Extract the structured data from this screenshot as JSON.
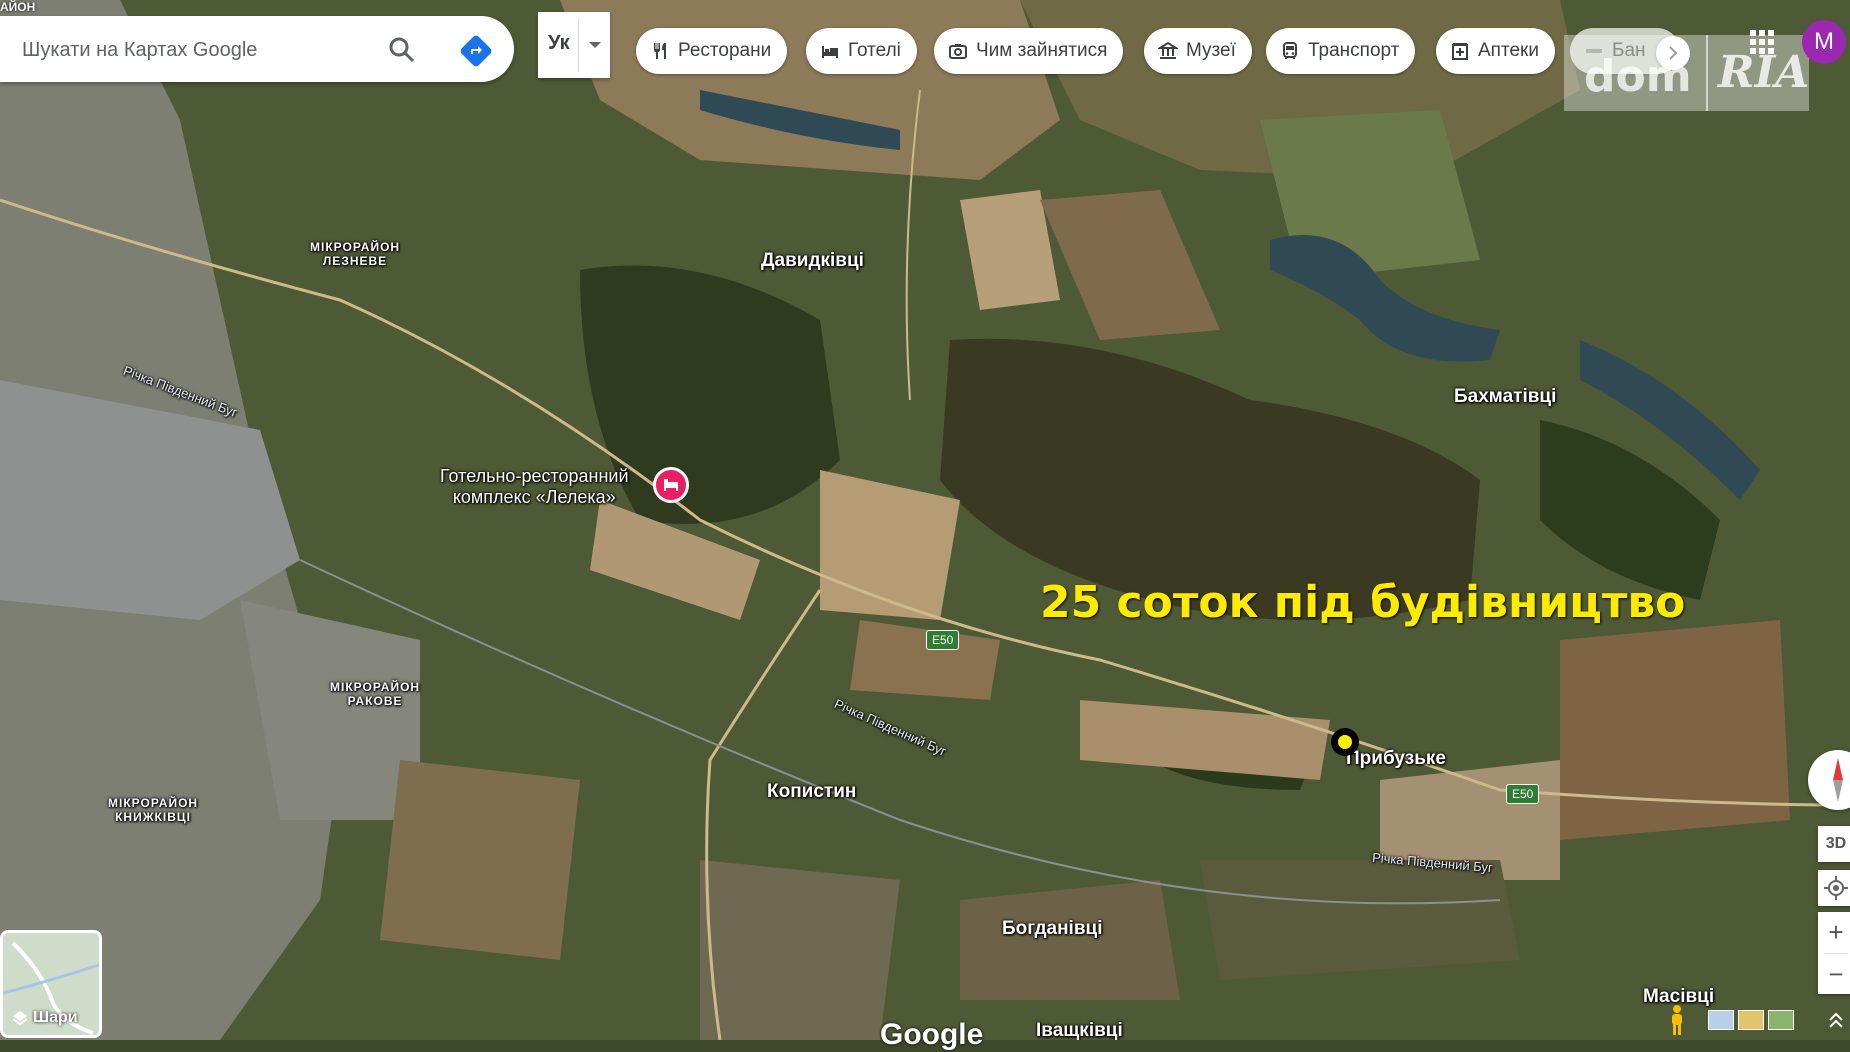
{
  "search": {
    "placeholder": "Шукати на Картах Google"
  },
  "language": {
    "label": "Ук"
  },
  "chips": [
    {
      "label": "Ресторани",
      "icon": "restaurant-icon"
    },
    {
      "label": "Готелі",
      "icon": "hotel-icon"
    },
    {
      "label": "Чим зайнятися",
      "icon": "camera-icon"
    },
    {
      "label": "Музеї",
      "icon": "museum-icon"
    },
    {
      "label": "Транспорт",
      "icon": "transit-icon"
    },
    {
      "label": "Аптеки",
      "icon": "pharmacy-icon"
    },
    {
      "label": "Бан",
      "icon": "bank-icon"
    }
  ],
  "watermark": {
    "left": "dom",
    "right": "RIA"
  },
  "account": {
    "initial": "M",
    "color": "#9c27b0"
  },
  "corner_fragment": "АЙОН",
  "places": {
    "leznevo": [
      "МІКРОРАЙОН",
      "ЛЕЗНЕВЕ"
    ],
    "rakove": [
      "МІКРОРАЙОН",
      "РАКОВЕ"
    ],
    "knyzhkivtsi": [
      "МІКРОРАЙОН",
      "КНИЖКІВЦІ"
    ],
    "davydkivtsi": "Давидківці",
    "bakhmativtsi": "Бахматівці",
    "prybuzke": "Прибузьке",
    "kopystyn": "Копистин",
    "bohdanivtsi": "Богданівці",
    "ivashkivtsi": "Іващківці",
    "masivtsi": "Масівці",
    "river_1": "Річка Південний Буг",
    "river_2": "Річка Південний Буг",
    "river_3": "Річка Південний Буг"
  },
  "poi": {
    "line1": "Готельно-ресторанний",
    "line2": "комплекс «Лелека»"
  },
  "road": {
    "shield_1": "E50",
    "shield_2": "E50"
  },
  "headline": "25 соток під будівництво",
  "layers": {
    "label": "Шари"
  },
  "controls": {
    "three_d": "3D",
    "zoom_in": "+",
    "zoom_out": "−"
  },
  "google_logo": "Google",
  "colors": {
    "headline": "#ffeb00",
    "marker_fill": "#ffee00",
    "poi_pin": "#e91e63",
    "road_shield": "#2e7d32"
  }
}
